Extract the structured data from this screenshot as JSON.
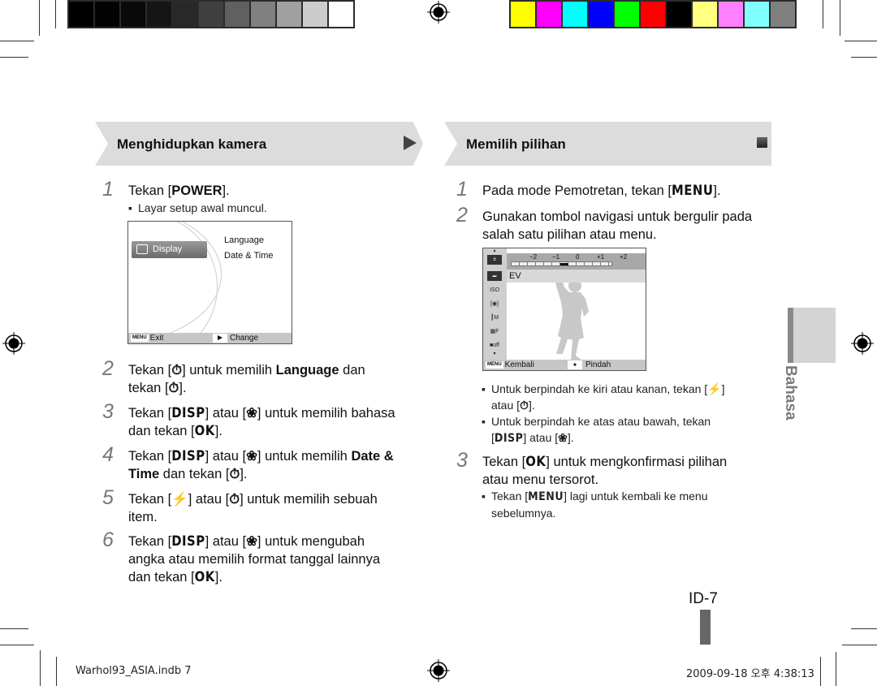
{
  "color_bars": {
    "grayscale": [
      "#000000",
      "#030303",
      "#0a0a0a",
      "#151515",
      "#282828",
      "#404040",
      "#606060",
      "#808080",
      "#a0a0a0",
      "#cccccc",
      "#ffffff"
    ],
    "color": [
      "#ffff00",
      "#ff00ff",
      "#00ffff",
      "#0000ff",
      "#00ff00",
      "#ff0000",
      "#000000",
      "#ffff80",
      "#ff80ff",
      "#80ffff",
      "#808080"
    ]
  },
  "left_section": {
    "title": "Menghidupkan kamera",
    "steps": [
      {
        "num": "1",
        "parts": [
          "Tekan [",
          "POWER",
          "]."
        ]
      },
      {
        "num": "2",
        "parts": [
          "Tekan [",
          "timer-icon",
          "] untuk memilih ",
          "Language",
          " dan",
          "tekan [",
          "timer-icon",
          "]."
        ]
      },
      {
        "num": "3",
        "parts": [
          "Tekan [",
          "DISP",
          "] atau [",
          "macro-icon",
          "] untuk memilih bahasa",
          "dan tekan [",
          "OK",
          "]."
        ]
      },
      {
        "num": "4",
        "parts": [
          "Tekan [",
          "DISP",
          "] atau [",
          "macro-icon",
          "] untuk memilih ",
          "Date &",
          "Time",
          " dan tekan [",
          "timer-icon",
          "]."
        ]
      },
      {
        "num": "5",
        "parts": [
          "Tekan [",
          "flash-icon",
          "] atau [",
          "timer-icon",
          "] untuk memilih sebuah",
          "item."
        ]
      },
      {
        "num": "6",
        "parts": [
          "Tekan [",
          "DISP",
          "] atau [",
          "macro-icon",
          "] untuk mengubah",
          "angka atau memilih format tanggal lainnya",
          "dan tekan [",
          "OK",
          "]."
        ]
      }
    ],
    "step1_note": "Layar setup awal muncul.",
    "lcd": {
      "tab": "Display",
      "options": [
        "Language",
        "Date & Time"
      ],
      "footer_menu": "MENU",
      "footer_left": "Exit",
      "footer_right": "Change"
    }
  },
  "right_section": {
    "title": "Memilih pilihan",
    "step1": {
      "num": "1",
      "text": "Pada mode Pemotretan, tekan [",
      "key": "MENU",
      "end": "]."
    },
    "step2": {
      "num": "2",
      "line1": "Gunakan tombol navigasi untuk bergulir pada",
      "line2": "salah satu pilihan atau menu."
    },
    "lcd": {
      "ticks": [
        "−2",
        "−1",
        "0",
        "+1",
        "+2"
      ],
      "ev_value": 0,
      "row_label": "EV",
      "footer_menu": "MENU",
      "footer_left": "Kembali",
      "footer_right": "Pindah"
    },
    "bullets": [
      {
        "l1a": "Untuk berpindah ke kiri atau kanan, tekan [",
        "l1b": "]",
        "l2a": "atau [",
        "l2b": "]."
      },
      {
        "l1": "Untuk berpindah ke atas atau bawah, tekan",
        "l2a": "[",
        "key": "DISP",
        "l2b": "] atau [",
        "l2c": "]."
      }
    ],
    "step3": {
      "num": "3",
      "a": "Tekan [",
      "key": "OK",
      "b": "] untuk mengkonfirmasi pilihan",
      "line2": "atau menu tersorot."
    },
    "step3_note": {
      "a": "Tekan [",
      "key": "MENU",
      "b": "] lagi untuk kembali ke menu",
      "line2": "sebelumnya."
    }
  },
  "side_tab_label": "Bahasa",
  "page_number": "ID-7",
  "slug": {
    "file": "Warhol93_ASIA.indb   7",
    "datetime": "2009-09-18   오후 4:38:13"
  }
}
